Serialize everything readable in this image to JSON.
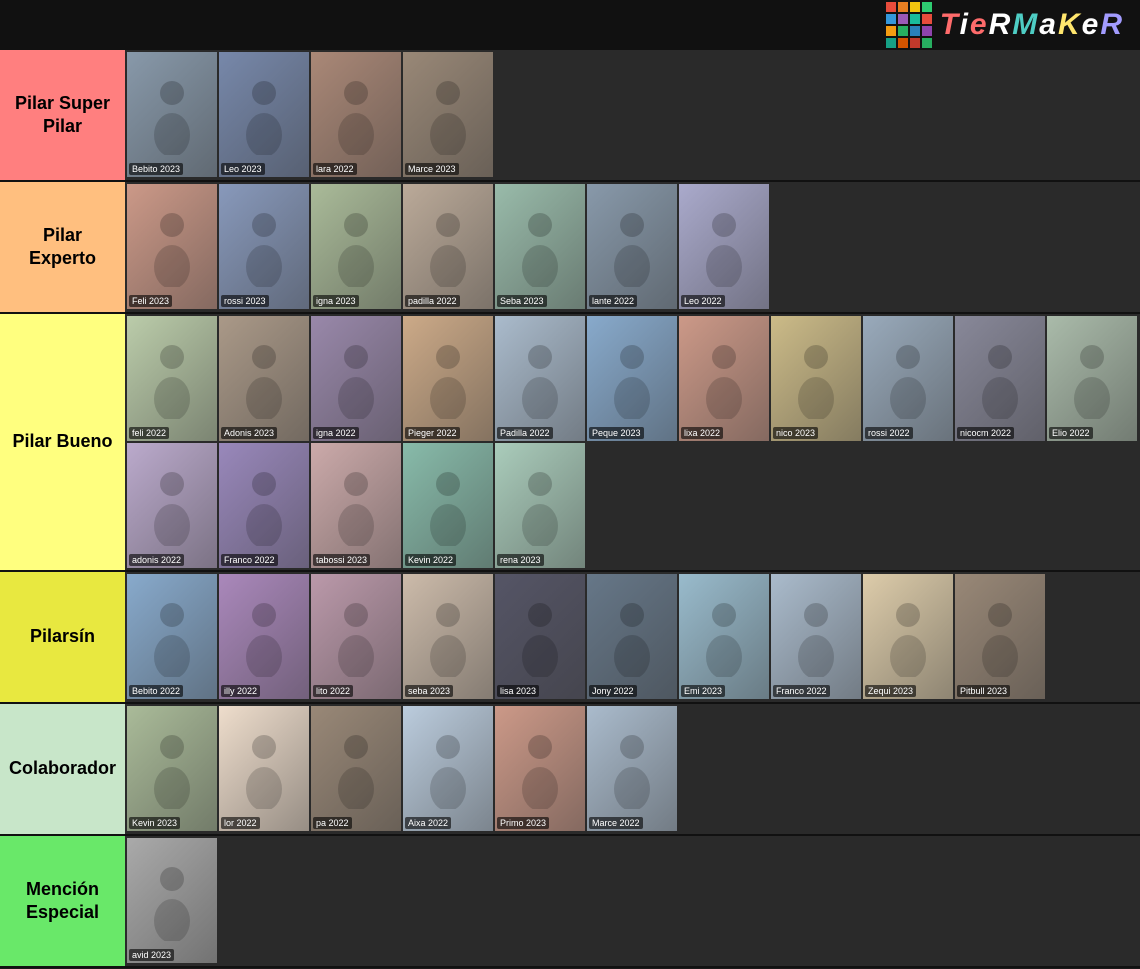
{
  "header": {
    "logo_text": "TieRMaKeR"
  },
  "tiers": [
    {
      "id": "pilar-super-pilar",
      "label": "Pilar Super Pilar",
      "color": "#ff7f7f",
      "items": [
        {
          "label": "Bebito 2023",
          "color": "#8899aa"
        },
        {
          "label": "Leo 2023",
          "color": "#7788aa"
        },
        {
          "label": "lara 2022",
          "color": "#aa8877"
        },
        {
          "label": "Marce 2023",
          "color": "#998877"
        }
      ]
    },
    {
      "id": "pilar-experto",
      "label": "Pilar Experto",
      "color": "#ffbf7f",
      "items": [
        {
          "label": "Feli 2023",
          "color": "#cc9988"
        },
        {
          "label": "rossi 2023",
          "color": "#8899bb"
        },
        {
          "label": "igna 2023",
          "color": "#aabb99"
        },
        {
          "label": "padilla 2022",
          "color": "#bbaa99"
        },
        {
          "label": "Seba 2023",
          "color": "#99bbaa"
        },
        {
          "label": "lante 2022",
          "color": "#8899aa"
        },
        {
          "label": "Leo 2022",
          "color": "#aaaacc"
        }
      ]
    },
    {
      "id": "pilar-bueno",
      "label": "Pilar Bueno",
      "color": "#ffff7f",
      "items": [
        {
          "label": "feli 2022",
          "color": "#bbccaa"
        },
        {
          "label": "Adonis 2023",
          "color": "#aa9988"
        },
        {
          "label": "igna 2022",
          "color": "#9988aa"
        },
        {
          "label": "Pieger 2022",
          "color": "#ccaa88"
        },
        {
          "label": "Padilla 2022",
          "color": "#aabbcc"
        },
        {
          "label": "Peque 2023",
          "color": "#88aacc"
        },
        {
          "label": "lixa 2022",
          "color": "#cc9988"
        },
        {
          "label": "nico 2023",
          "color": "#ccbb88"
        },
        {
          "label": "rossi 2022",
          "color": "#99aabb"
        },
        {
          "label": "nicocm 2022",
          "color": "#888899"
        },
        {
          "label": "Elio 2022",
          "color": "#aabbaa"
        },
        {
          "label": "adonis 2022",
          "color": "#bbaacc"
        },
        {
          "label": "Franco 2022",
          "color": "#9988bb"
        },
        {
          "label": "tabossi 2023",
          "color": "#ccaaaa"
        },
        {
          "label": "Kevin 2022",
          "color": "#88bbaa"
        },
        {
          "label": "rena 2023",
          "color": "#aaccbb"
        }
      ]
    },
    {
      "id": "pilarsin",
      "label": "Pilarsín",
      "color": "#e8e840",
      "items": [
        {
          "label": "Bebito 2022",
          "color": "#88aacc"
        },
        {
          "label": "illy 2022",
          "color": "#aa88bb"
        },
        {
          "label": "lito 2022",
          "color": "#bb99aa"
        },
        {
          "label": "seba 2023",
          "color": "#ccbbaa"
        },
        {
          "label": "lisa 2023",
          "color": "#555566"
        },
        {
          "label": "Jony 2022",
          "color": "#667788"
        },
        {
          "label": "Emi 2023",
          "color": "#99bbcc"
        },
        {
          "label": "Franco 2022",
          "color": "#aabbcc"
        },
        {
          "label": "Zequi 2023",
          "color": "#ddccaa"
        },
        {
          "label": "Pitbull 2023",
          "color": "#998877"
        }
      ]
    },
    {
      "id": "colaborador",
      "label": "Colaborador",
      "color": "#c8e6c9",
      "items": [
        {
          "label": "Kevin 2023",
          "color": "#aabb99"
        },
        {
          "label": "lor 2022",
          "color": "#eeddcc"
        },
        {
          "label": "pa 2022",
          "color": "#998877"
        },
        {
          "label": "Aixa 2022",
          "color": "#bbccdd"
        },
        {
          "label": "Primo 2023",
          "color": "#cc9988"
        },
        {
          "label": "Marce 2022",
          "color": "#aabbcc"
        }
      ]
    },
    {
      "id": "mencion-especial",
      "label": "Mención Especial",
      "color": "#69e869",
      "items": [
        {
          "label": "avid 2023",
          "color": "#aaaaaa"
        }
      ]
    }
  ],
  "logo_colors": [
    "#e74c3c",
    "#e67e22",
    "#f1c40f",
    "#2ecc71",
    "#3498db",
    "#9b59b6",
    "#1abc9c",
    "#e74c3c",
    "#f39c12",
    "#27ae60",
    "#2980b9",
    "#8e44ad",
    "#16a085",
    "#d35400",
    "#c0392b",
    "#27ae60"
  ]
}
